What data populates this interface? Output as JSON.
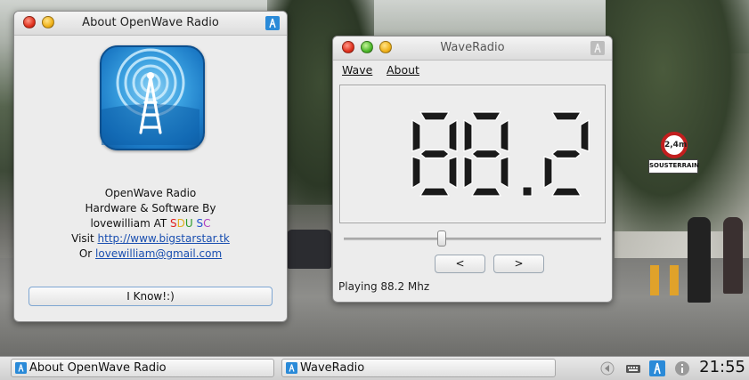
{
  "about_window": {
    "title": "About OpenWave Radio",
    "app_name": "OpenWave Radio",
    "line_hw": "Hardware & Software By",
    "author_prefix": "lovewilliam AT ",
    "sdu_s": "S",
    "sdu_d": "D",
    "sdu_u": "U",
    "sc_s": "S",
    "sc_c": "C",
    "visit_label": "Visit",
    "website": "http://www.bigstarstar.tk",
    "or_label": "Or",
    "email": "lovewilliam@gmail.com",
    "ok_button": "I Know!:)"
  },
  "radio_window": {
    "title": "WaveRadio",
    "menu": {
      "wave": "Wave",
      "about": "About"
    },
    "frequency_display": "88.2",
    "prev_label": "<",
    "next_label": ">",
    "status": "Playing 88.2 Mhz"
  },
  "taskbar": {
    "items": [
      {
        "label": "About OpenWave Radio"
      },
      {
        "label": "WaveRadio"
      }
    ],
    "clock": "21:55"
  },
  "background": {
    "road_sign_limit": "2,4m",
    "street_plate": "SOUSTERRAIN"
  },
  "colors": {
    "accent_blue": "#1a78c4",
    "close": "#e0321e",
    "minimize": "#f0b21a",
    "maximize": "#4cb82a"
  }
}
